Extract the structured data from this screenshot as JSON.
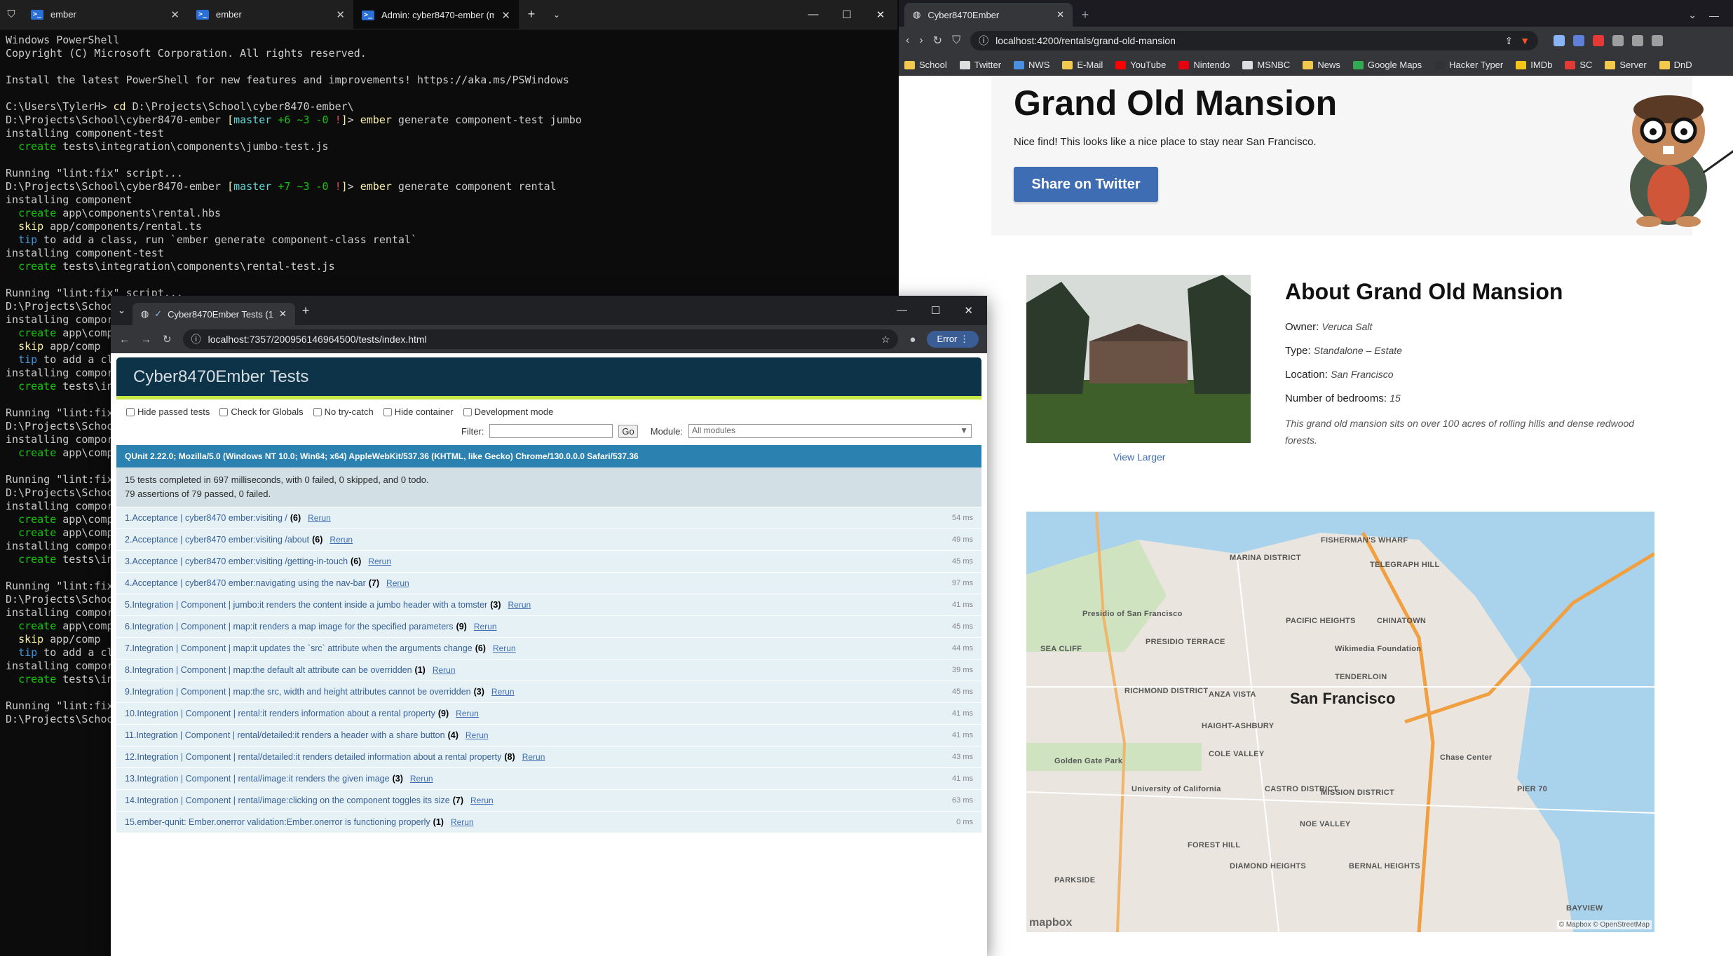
{
  "terminal": {
    "tabs": [
      {
        "label": "ember"
      },
      {
        "label": "ember"
      },
      {
        "label": "Admin: cyber8470-ember (ma"
      }
    ],
    "lines": [
      [
        {
          "t": "Windows PowerShell"
        }
      ],
      [
        {
          "t": "Copyright (C) Microsoft Corporation. All rights reserved."
        }
      ],
      [
        {
          "t": ""
        }
      ],
      [
        {
          "t": "Install the latest PowerShell for new features and improvements! https://aka.ms/PSWindows"
        }
      ],
      [
        {
          "t": ""
        }
      ],
      [
        {
          "t": "C:\\Users\\TylerH> "
        },
        {
          "t": "cd",
          "c": "y"
        },
        {
          "t": " D:\\Projects\\School\\cyber8470-ember\\"
        }
      ],
      [
        {
          "t": "D:\\Projects\\School\\cyber8470-ember "
        },
        {
          "t": "[",
          "c": "y"
        },
        {
          "t": "master",
          "c": "c"
        },
        {
          "t": " +6",
          "c": "g"
        },
        {
          "t": " ~3",
          "c": "g"
        },
        {
          "t": " -0",
          "c": "g"
        },
        {
          "t": " !",
          "c": "r"
        },
        {
          "t": "]",
          "c": "y"
        },
        {
          "t": "> "
        },
        {
          "t": "ember",
          "c": "y"
        },
        {
          "t": " generate component-test jumbo"
        }
      ],
      [
        {
          "t": "installing component-test"
        }
      ],
      [
        {
          "t": "  "
        },
        {
          "t": "create",
          "c": "g"
        },
        {
          "t": " tests\\integration\\components\\jumbo-test.js"
        }
      ],
      [
        {
          "t": ""
        }
      ],
      [
        {
          "t": "Running \"lint:fix\" script..."
        }
      ],
      [
        {
          "t": "D:\\Projects\\School\\cyber8470-ember "
        },
        {
          "t": "[",
          "c": "y"
        },
        {
          "t": "master",
          "c": "c"
        },
        {
          "t": " +7",
          "c": "g"
        },
        {
          "t": " ~3",
          "c": "g"
        },
        {
          "t": " -0",
          "c": "g"
        },
        {
          "t": " !",
          "c": "r"
        },
        {
          "t": "]",
          "c": "y"
        },
        {
          "t": "> "
        },
        {
          "t": "ember",
          "c": "y"
        },
        {
          "t": " generate component rental"
        }
      ],
      [
        {
          "t": "installing component"
        }
      ],
      [
        {
          "t": "  "
        },
        {
          "t": "create",
          "c": "g"
        },
        {
          "t": " app\\components\\rental.hbs"
        }
      ],
      [
        {
          "t": "  "
        },
        {
          "t": "skip",
          "c": "y"
        },
        {
          "t": " app/components/rental.ts"
        }
      ],
      [
        {
          "t": "  "
        },
        {
          "t": "tip",
          "c": "gr"
        },
        {
          "t": " to add a class, run `ember generate component-class rental`"
        }
      ],
      [
        {
          "t": "installing component-test"
        }
      ],
      [
        {
          "t": "  "
        },
        {
          "t": "create",
          "c": "g"
        },
        {
          "t": " tests\\integration\\components\\rental-test.js"
        }
      ],
      [
        {
          "t": ""
        }
      ],
      [
        {
          "t": "Running \"lint:fix\" script..."
        }
      ],
      [
        {
          "t": "D:\\Projects\\School"
        }
      ],
      [
        {
          "t": "installing compor"
        }
      ],
      [
        {
          "t": "  "
        },
        {
          "t": "create",
          "c": "g"
        },
        {
          "t": " app\\comp"
        }
      ],
      [
        {
          "t": "  "
        },
        {
          "t": "skip",
          "c": "y"
        },
        {
          "t": " app/comp"
        }
      ],
      [
        {
          "t": "  "
        },
        {
          "t": "tip",
          "c": "gr"
        },
        {
          "t": " to add a cl"
        }
      ],
      [
        {
          "t": "installing compor"
        }
      ],
      [
        {
          "t": "  "
        },
        {
          "t": "create",
          "c": "g"
        },
        {
          "t": " tests\\in"
        }
      ],
      [
        {
          "t": ""
        }
      ],
      [
        {
          "t": "Running \"lint:fix"
        }
      ],
      [
        {
          "t": "D:\\Projects\\Schoo"
        }
      ],
      [
        {
          "t": "installing compor"
        }
      ],
      [
        {
          "t": "  "
        },
        {
          "t": "create",
          "c": "g"
        },
        {
          "t": " app\\comp"
        }
      ],
      [
        {
          "t": ""
        }
      ],
      [
        {
          "t": "Running \"lint:fix"
        }
      ],
      [
        {
          "t": "D:\\Projects\\Schoo"
        }
      ],
      [
        {
          "t": "installing compor"
        }
      ],
      [
        {
          "t": "  "
        },
        {
          "t": "create",
          "c": "g"
        },
        {
          "t": " app\\comp"
        }
      ],
      [
        {
          "t": "  "
        },
        {
          "t": "create",
          "c": "g"
        },
        {
          "t": " app\\comp"
        }
      ],
      [
        {
          "t": "installing compor"
        }
      ],
      [
        {
          "t": "  "
        },
        {
          "t": "create",
          "c": "g"
        },
        {
          "t": " tests\\in"
        }
      ],
      [
        {
          "t": ""
        }
      ],
      [
        {
          "t": "Running \"lint:fix"
        }
      ],
      [
        {
          "t": "D:\\Projects\\Schoo"
        }
      ],
      [
        {
          "t": "installing compor"
        }
      ],
      [
        {
          "t": "  "
        },
        {
          "t": "create",
          "c": "g"
        },
        {
          "t": " app\\comp"
        }
      ],
      [
        {
          "t": "  "
        },
        {
          "t": "skip",
          "c": "y"
        },
        {
          "t": " app/comp"
        }
      ],
      [
        {
          "t": "  "
        },
        {
          "t": "tip",
          "c": "gr"
        },
        {
          "t": " to add a cl"
        }
      ],
      [
        {
          "t": "installing compor"
        }
      ],
      [
        {
          "t": "  "
        },
        {
          "t": "create",
          "c": "g"
        },
        {
          "t": " tests\\in"
        }
      ],
      [
        {
          "t": ""
        }
      ],
      [
        {
          "t": "Running \"lint:fix"
        }
      ],
      [
        {
          "t": "D:\\Projects\\Schoo"
        }
      ]
    ]
  },
  "browser": {
    "tab_label": "Cyber8470Ember",
    "url": "localhost:4200/rentals/grand-old-mansion",
    "bookmarks": [
      "School",
      "Twitter",
      "NWS",
      "E-Mail",
      "YouTube",
      "Nintendo",
      "MSNBC",
      "News",
      "Google Maps",
      "Hacker Typer",
      "IMDb",
      "SC",
      "Server",
      "DnD"
    ],
    "page": {
      "title": "Grand Old Mansion",
      "tagline": "Nice find! This looks like a nice place to stay near San Francisco.",
      "share_button": "Share on Twitter",
      "view_larger": "View Larger",
      "about_title": "About Grand Old Mansion",
      "owner_label": "Owner:",
      "owner": "Veruca Salt",
      "type_label": "Type:",
      "type": "Standalone – Estate",
      "location_label": "Location:",
      "location": "San Francisco",
      "bedrooms_label": "Number of bedrooms:",
      "bedrooms": "15",
      "description": "This grand old mansion sits on over 100 acres of rolling hills and dense redwood forests.",
      "map": {
        "city": "San Francisco",
        "labels": [
          "MARINA DISTRICT",
          "TELEGRAPH HILL",
          "FISHERMAN'S WHARF",
          "Presidio of San Francisco",
          "PACIFIC HEIGHTS",
          "CHINATOWN",
          "Wikimedia Foundation",
          "TENDERLOIN",
          "RICHMOND DISTRICT",
          "ANZA VISTA",
          "HAIGHT-ASHBURY",
          "Golden Gate Park",
          "COLE VALLEY",
          "University of California",
          "CASTRO DISTRICT",
          "MISSION DISTRICT",
          "NOE VALLEY",
          "Chase Center",
          "FOREST HILL",
          "DIAMOND HEIGHTS",
          "BERNAL HEIGHTS",
          "PARKSIDE",
          "SEA CLIFF",
          "PRESIDIO TERRACE",
          "BAYVIEW",
          "PIER 70"
        ],
        "attribution": "© Mapbox © OpenStreetMap",
        "logo": "mapbox"
      }
    }
  },
  "tests": {
    "tab_label": "Cyber8470Ember Tests (15/",
    "url": "localhost:7357/200956146964500/tests/index.html",
    "error_pill": "Error",
    "header": "Cyber8470Ember Tests",
    "checks": [
      "Hide passed tests",
      "Check for Globals",
      "No try-catch",
      "Hide container",
      "Development mode"
    ],
    "filter_label": "Filter:",
    "go": "Go",
    "module_label": "Module:",
    "module_value": "All modules",
    "user_agent": "QUnit 2.22.0; Mozilla/5.0 (Windows NT 10.0; Win64; x64) AppleWebKit/537.36 (KHTML, like Gecko) Chrome/130.0.0.0 Safari/537.36",
    "result_line1": "15 tests completed in 697 milliseconds, with 0 failed, 0 skipped, and 0 todo.",
    "result_line2": "79 assertions of 79 passed, 0 failed.",
    "rerun": "Rerun",
    "items": [
      {
        "n": "1.",
        "mod": "Acceptance | cyber8470 ember:",
        "name": "visiting /",
        "count": "(6)",
        "time": "54 ms"
      },
      {
        "n": "2.",
        "mod": "Acceptance | cyber8470 ember:",
        "name": "visiting /about",
        "count": "(6)",
        "time": "49 ms"
      },
      {
        "n": "3.",
        "mod": "Acceptance | cyber8470 ember:",
        "name": "visiting /getting-in-touch",
        "count": "(6)",
        "time": "45 ms"
      },
      {
        "n": "4.",
        "mod": "Acceptance | cyber8470 ember:",
        "name": "navigating using the nav-bar",
        "count": "(7)",
        "time": "97 ms"
      },
      {
        "n": "5.",
        "mod": "Integration | Component | jumbo:",
        "name": "it renders the content inside a jumbo header with a tomster",
        "count": "(3)",
        "time": "41 ms"
      },
      {
        "n": "6.",
        "mod": "Integration | Component | map:",
        "name": "it renders a map image for the specified parameters",
        "count": "(9)",
        "time": "45 ms"
      },
      {
        "n": "7.",
        "mod": "Integration | Component | map:",
        "name": "it updates the `src` attribute when the arguments change",
        "count": "(6)",
        "time": "44 ms"
      },
      {
        "n": "8.",
        "mod": "Integration | Component | map:",
        "name": "the default alt attribute can be overridden",
        "count": "(1)",
        "time": "39 ms"
      },
      {
        "n": "9.",
        "mod": "Integration | Component | map:",
        "name": "the src, width and height attributes cannot be overridden",
        "count": "(3)",
        "time": "45 ms"
      },
      {
        "n": "10.",
        "mod": "Integration | Component | rental:",
        "name": "it renders information about a rental property",
        "count": "(9)",
        "time": "41 ms"
      },
      {
        "n": "11.",
        "mod": "Integration | Component | rental/detailed:",
        "name": "it renders a header with a share button",
        "count": "(4)",
        "time": "41 ms"
      },
      {
        "n": "12.",
        "mod": "Integration | Component | rental/detailed:",
        "name": "it renders detailed information about a rental property",
        "count": "(8)",
        "time": "43 ms"
      },
      {
        "n": "13.",
        "mod": "Integration | Component | rental/image:",
        "name": "it renders the given image",
        "count": "(3)",
        "time": "41 ms"
      },
      {
        "n": "14.",
        "mod": "Integration | Component | rental/image:",
        "name": "clicking on the component toggles its size",
        "count": "(7)",
        "time": "63 ms"
      },
      {
        "n": "15.",
        "mod": "ember-qunit: Ember.onerror validation:",
        "name": "Ember.onerror is functioning properly",
        "count": "(1)",
        "time": "0 ms"
      }
    ]
  }
}
